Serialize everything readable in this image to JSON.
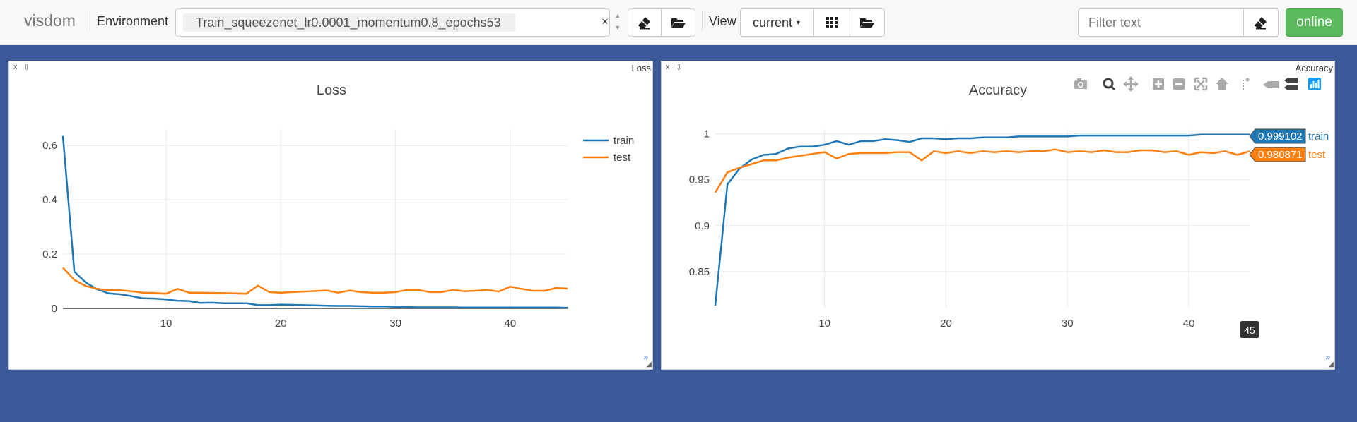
{
  "app": {
    "brand": "visdom",
    "environment_label": "Environment",
    "environment_value": "Train_squeezenet_lr0.0001_momentum0.8_epochs53",
    "clear_symbol": "×",
    "view_label": "View",
    "view_value": "current",
    "filter_placeholder": "Filter text",
    "online_label": "online"
  },
  "panes": [
    {
      "title": "Loss",
      "close_symbol": "x",
      "download_symbol": "⇩"
    },
    {
      "title": "Accuracy",
      "close_symbol": "x",
      "download_symbol": "⇩"
    }
  ],
  "tooltip": {
    "x_value": "45",
    "train_value": "0.999102",
    "test_value": "0.980871",
    "train_name": "train",
    "test_name": "test"
  },
  "chart_data": [
    {
      "type": "line",
      "title": "Loss",
      "xlabel": "",
      "ylabel": "",
      "x_ticks": [
        10,
        20,
        30,
        40
      ],
      "y_ticks": [
        "0",
        "0.2",
        "0.4",
        "0.6"
      ],
      "xlim": [
        1,
        45
      ],
      "ylim": [
        0,
        0.66
      ],
      "legend_position": "top-right",
      "colors": {
        "train": "#1f77b4",
        "test": "#ff7f0e"
      },
      "x": [
        1,
        2,
        3,
        4,
        5,
        6,
        7,
        8,
        9,
        10,
        11,
        12,
        13,
        14,
        15,
        16,
        17,
        18,
        19,
        20,
        21,
        22,
        23,
        24,
        25,
        26,
        27,
        28,
        29,
        30,
        31,
        32,
        33,
        34,
        35,
        36,
        37,
        38,
        39,
        40,
        41,
        42,
        43,
        44,
        45
      ],
      "series": [
        {
          "name": "train",
          "values": [
            0.635,
            0.135,
            0.095,
            0.07,
            0.055,
            0.052,
            0.045,
            0.037,
            0.036,
            0.033,
            0.028,
            0.027,
            0.02,
            0.021,
            0.019,
            0.019,
            0.019,
            0.012,
            0.012,
            0.014,
            0.013,
            0.012,
            0.011,
            0.01,
            0.009,
            0.009,
            0.008,
            0.007,
            0.007,
            0.006,
            0.005,
            0.004,
            0.004,
            0.004,
            0.004,
            0.003,
            0.003,
            0.003,
            0.003,
            0.003,
            0.003,
            0.003,
            0.003,
            0.003,
            0.002
          ]
        },
        {
          "name": "test",
          "values": [
            0.15,
            0.105,
            0.082,
            0.072,
            0.067,
            0.067,
            0.063,
            0.058,
            0.057,
            0.054,
            0.072,
            0.058,
            0.058,
            0.057,
            0.056,
            0.055,
            0.054,
            0.084,
            0.06,
            0.058,
            0.06,
            0.062,
            0.064,
            0.066,
            0.058,
            0.066,
            0.06,
            0.058,
            0.058,
            0.06,
            0.068,
            0.068,
            0.06,
            0.06,
            0.068,
            0.063,
            0.065,
            0.068,
            0.062,
            0.08,
            0.072,
            0.065,
            0.065,
            0.075,
            0.073
          ]
        }
      ]
    },
    {
      "type": "line",
      "title": "Accuracy",
      "xlabel": "",
      "ylabel": "",
      "x_ticks": [
        10,
        20,
        30,
        40
      ],
      "y_ticks": [
        "0.85",
        "0.9",
        "0.95",
        "1"
      ],
      "xlim": [
        1,
        45
      ],
      "ylim": [
        0.81,
        1.005
      ],
      "legend_position": "none",
      "colors": {
        "train": "#1f77b4",
        "test": "#ff7f0e"
      },
      "x": [
        1,
        2,
        3,
        4,
        5,
        6,
        7,
        8,
        9,
        10,
        11,
        12,
        13,
        14,
        15,
        16,
        17,
        18,
        19,
        20,
        21,
        22,
        23,
        24,
        25,
        26,
        27,
        28,
        29,
        30,
        31,
        32,
        33,
        34,
        35,
        36,
        37,
        38,
        39,
        40,
        41,
        42,
        43,
        44,
        45
      ],
      "series": [
        {
          "name": "train",
          "values": [
            0.813,
            0.945,
            0.962,
            0.972,
            0.977,
            0.978,
            0.984,
            0.986,
            0.986,
            0.988,
            0.992,
            0.988,
            0.992,
            0.992,
            0.994,
            0.993,
            0.991,
            0.995,
            0.995,
            0.994,
            0.995,
            0.995,
            0.996,
            0.996,
            0.996,
            0.997,
            0.997,
            0.997,
            0.997,
            0.997,
            0.998,
            0.998,
            0.998,
            0.998,
            0.998,
            0.998,
            0.998,
            0.998,
            0.998,
            0.998,
            0.999,
            0.999,
            0.999,
            0.999,
            0.999
          ]
        },
        {
          "name": "test",
          "values": [
            0.936,
            0.958,
            0.963,
            0.967,
            0.971,
            0.971,
            0.974,
            0.976,
            0.978,
            0.98,
            0.973,
            0.978,
            0.979,
            0.979,
            0.979,
            0.98,
            0.98,
            0.971,
            0.981,
            0.979,
            0.981,
            0.979,
            0.981,
            0.98,
            0.981,
            0.98,
            0.981,
            0.981,
            0.983,
            0.98,
            0.981,
            0.98,
            0.982,
            0.98,
            0.98,
            0.982,
            0.982,
            0.98,
            0.981,
            0.977,
            0.98,
            0.979,
            0.981,
            0.977,
            0.981
          ]
        }
      ]
    }
  ]
}
